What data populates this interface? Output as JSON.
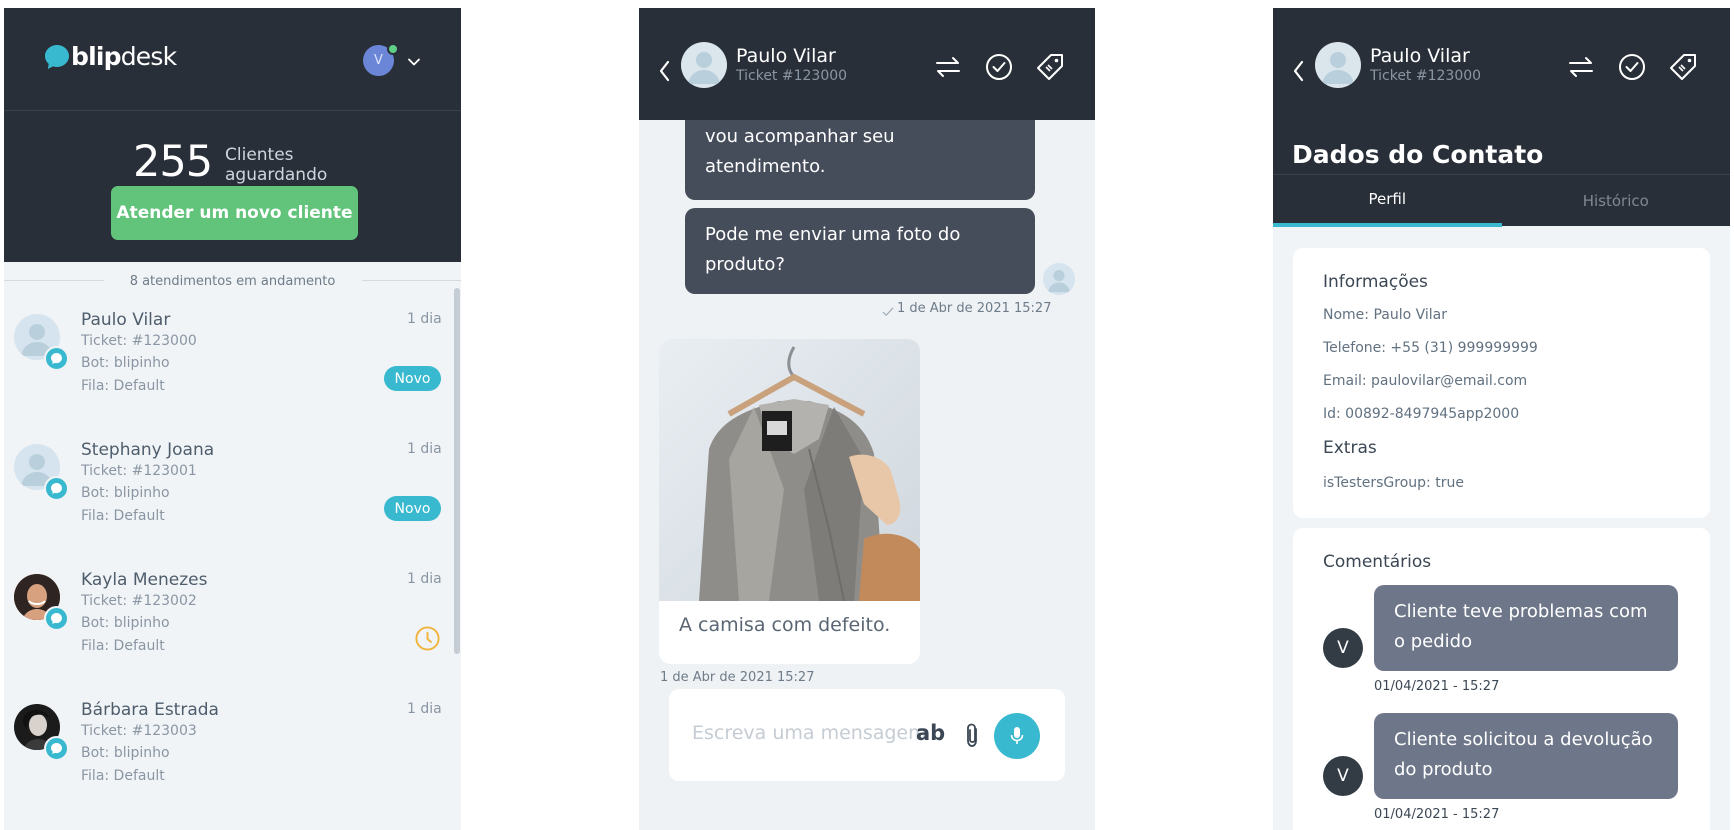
{
  "inbox": {
    "logo": {
      "bold": "blip",
      "regular": "desk"
    },
    "user_initial": "V",
    "waiting_count": "255",
    "waiting_label_1": "Clientes",
    "waiting_label_2": "aguardando",
    "attend_button": "Atender um novo cliente",
    "ongoing_label": "8 atendimentos em andamento",
    "tickets": [
      {
        "name": "Paulo Vilar",
        "ticket": "Ticket: #123000",
        "bot": "Bot: blipinho",
        "queue": "Fila: Default",
        "age": "1 dia",
        "status": "Novo"
      },
      {
        "name": "Stephany Joana",
        "ticket": "Ticket: #123001",
        "bot": "Bot: blipinho",
        "queue": "Fila: Default",
        "age": "1 dia",
        "status": "Novo"
      },
      {
        "name": "Kayla Menezes",
        "ticket": "Ticket: #123002",
        "bot": "Bot: blipinho",
        "queue": "Fila: Default",
        "age": "1 dia",
        "status": "clock"
      },
      {
        "name": "Bárbara Estrada",
        "ticket": "Ticket: #123003",
        "bot": "Bot: blipinho",
        "queue": "Fila: Default",
        "age": "1 dia",
        "status": ""
      }
    ]
  },
  "chat": {
    "header": {
      "name": "Paulo Vilar",
      "ticket": "Ticket #123000"
    },
    "messages": [
      {
        "text_1": "vou acompanhar seu",
        "text_2": "atendimento."
      },
      {
        "text_1": "Pode me enviar uma foto do",
        "text_2": "produto?",
        "time": "1 de Abr de 2021 15:27"
      }
    ],
    "image_message": {
      "caption": "A camisa com defeito.",
      "time": "1 de Abr de 2021 15:27"
    },
    "composer": {
      "placeholder": "Escreva uma mensagem",
      "format_label": "ab"
    }
  },
  "contact": {
    "header": {
      "name": "Paulo Vilar",
      "ticket": "Ticket #123000"
    },
    "title": "Dados do Contato",
    "tabs": [
      "Perfil",
      "Histórico"
    ],
    "info": {
      "heading": "Informações",
      "name": "Nome: Paulo Vilar",
      "phone": "Telefone: +55 (31) 999999999",
      "email": "Email: paulovilar@email.com",
      "id": "Id: 00892-8497945app2000",
      "extras_heading": "Extras",
      "extras": "isTestersGroup: true"
    },
    "comments": {
      "heading": "Comentários",
      "items": [
        {
          "initial": "V",
          "text_1": "Cliente teve problemas com",
          "text_2": "o pedido",
          "time": "01/04/2021 - 15:27"
        },
        {
          "initial": "V",
          "text_1": "Cliente solicitou a devolução",
          "text_2": "do produto",
          "time": "01/04/2021 - 15:27"
        }
      ]
    }
  },
  "colors": {
    "dark": "#292f38",
    "accent": "#38b9cf",
    "primary_green": "#62c37a",
    "bubble_agent": "#454c5a",
    "bubble_comment": "#6e7789",
    "clock": "#f0b43c"
  },
  "icons": [
    "chat-bubble-icon",
    "chevron-down-icon",
    "back-icon",
    "transfer-icon",
    "check-circle-icon",
    "tag-icon",
    "clock-icon",
    "paperclip-icon",
    "mic-icon",
    "double-check-icon"
  ]
}
